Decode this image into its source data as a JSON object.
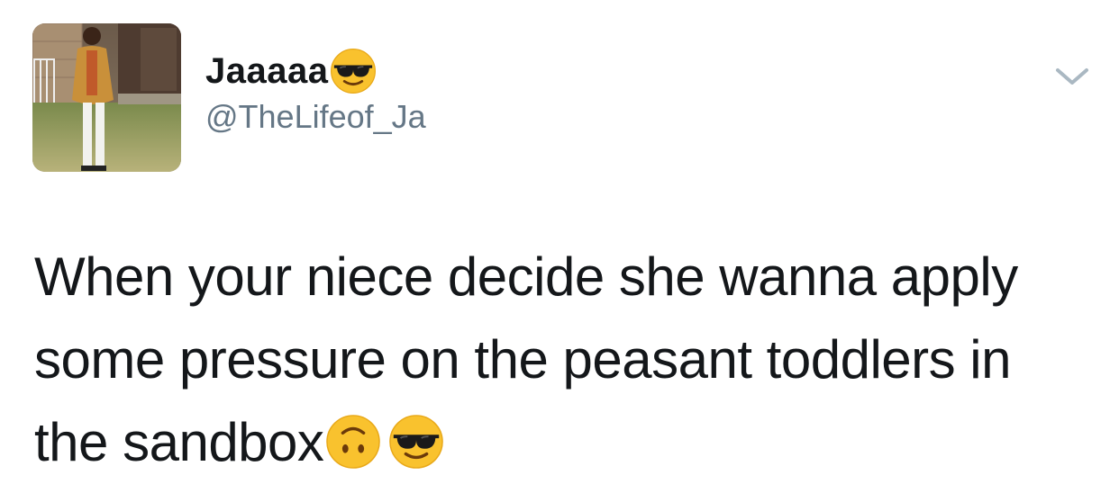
{
  "author": {
    "display_name": "Jaaaaa",
    "name_emoji": "smiling-face-with-sunglasses",
    "handle": "@TheLifeof_Ja"
  },
  "tweet": {
    "lines": [
      "When your niece decide she wanna apply",
      "some pressure on the peasant toddlers in",
      "the sandbox"
    ],
    "trailing_emojis": [
      "upside-down-face",
      "smiling-face-with-sunglasses"
    ]
  },
  "colors": {
    "text": "#14171a",
    "secondary": "#657786",
    "chevron": "#aab8c2",
    "emoji_yellow": "#f9c22e"
  },
  "icons": {
    "menu": "chevron-down-icon"
  }
}
